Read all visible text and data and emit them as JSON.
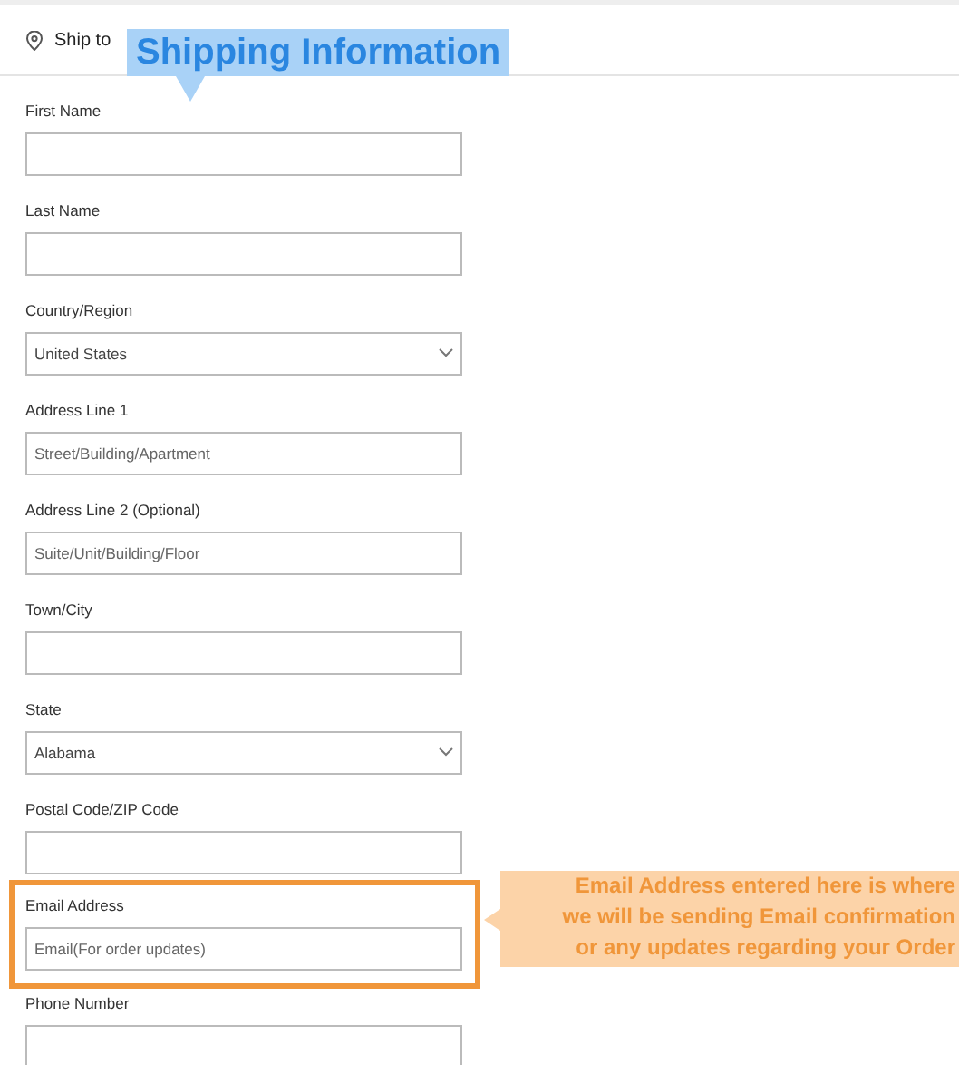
{
  "header": {
    "title": "Ship to"
  },
  "callout": {
    "text": "Shipping Information"
  },
  "fields": [
    {
      "label": "First Name",
      "kind": "text",
      "highlighted": false
    },
    {
      "label": "Last Name",
      "kind": "text",
      "highlighted": false
    },
    {
      "label": "Country/Region",
      "kind": "select",
      "value": "United States",
      "highlighted": false
    },
    {
      "label": "Address Line 1",
      "kind": "text",
      "placeholder": "Street/Building/Apartment",
      "highlighted": false
    },
    {
      "label": "Address Line 2 (Optional)",
      "kind": "text",
      "placeholder": "Suite/Unit/Building/Floor",
      "highlighted": false
    },
    {
      "label": "Town/City",
      "kind": "text",
      "highlighted": false
    },
    {
      "label": "State",
      "kind": "select",
      "value": "Alabama",
      "highlighted": false
    },
    {
      "label": "Postal Code/ZIP Code",
      "kind": "text",
      "highlighted": false
    },
    {
      "label": "Email Address",
      "kind": "text",
      "placeholder": "Email(For order updates)",
      "highlighted": true
    },
    {
      "label": "Phone Number",
      "kind": "text",
      "highlighted": false
    }
  ],
  "note": {
    "lines": [
      "Email Address entered here is where",
      "we will be sending Email confirmation",
      "or any updates regarding your Order"
    ]
  }
}
